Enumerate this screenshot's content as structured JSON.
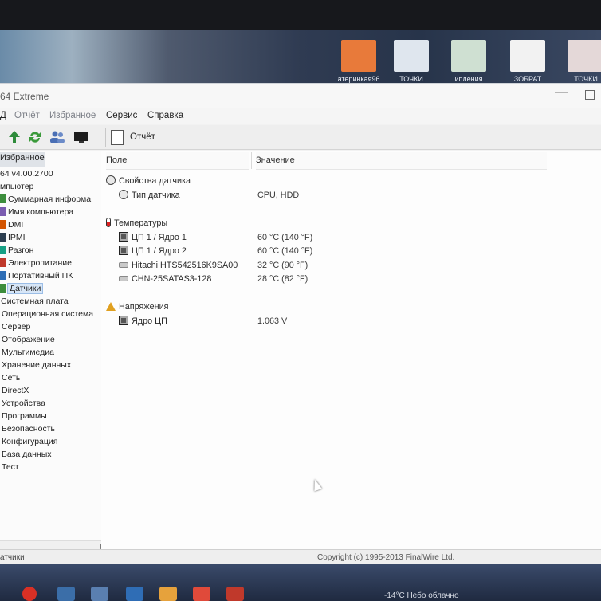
{
  "window": {
    "title": "64 Extreme"
  },
  "menu": [
    {
      "label": "Отчёт",
      "dim": true
    },
    {
      "label": "Избранное",
      "dim": true
    },
    {
      "label": "Сервис",
      "dim": false
    },
    {
      "label": "Справка",
      "dim": false
    }
  ],
  "menu_prefix": "Д",
  "desktop": {
    "labels": [
      "атеринкая96",
      "ТОЧКИ",
      "ипления",
      "ЗОБРАТ",
      "ТОЧКИ"
    ]
  },
  "toolbar": {
    "report_label": "Отчёт",
    "icons": [
      "up-arrow-icon",
      "refresh-icon",
      "users-icon",
      "monitor-icon"
    ]
  },
  "tree": {
    "header": "Избранное",
    "items": [
      {
        "label": "64 v4.00.2700",
        "level": 0
      },
      {
        "label": "мпьютер",
        "level": 0
      },
      {
        "label": "Суммарная информа",
        "level": 1
      },
      {
        "label": "Имя компьютера",
        "level": 1
      },
      {
        "label": "DMI",
        "level": 1
      },
      {
        "label": "IPMI",
        "level": 1
      },
      {
        "label": "Разгон",
        "level": 1
      },
      {
        "label": "Электропитание",
        "level": 1
      },
      {
        "label": "Портативный ПК",
        "level": 1
      },
      {
        "label": "Датчики",
        "level": 1,
        "selected": true
      },
      {
        "label": "Системная плата",
        "level": 0
      },
      {
        "label": "Операционная система",
        "level": 0
      },
      {
        "label": "Сервер",
        "level": 0
      },
      {
        "label": "Отображение",
        "level": 0
      },
      {
        "label": "Мультимедиа",
        "level": 0
      },
      {
        "label": "Хранение данных",
        "level": 0
      },
      {
        "label": "Сеть",
        "level": 0
      },
      {
        "label": "DirectX",
        "level": 0
      },
      {
        "label": "Устройства",
        "level": 0
      },
      {
        "label": "Программы",
        "level": 0
      },
      {
        "label": "Безопасность",
        "level": 0
      },
      {
        "label": "Конфигурация",
        "level": 0
      },
      {
        "label": "База данных",
        "level": 0
      },
      {
        "label": "Тест",
        "level": 0
      }
    ]
  },
  "columns": {
    "field": "Поле",
    "value": "Значение"
  },
  "sections": [
    {
      "title": "Свойства датчика",
      "icon": "gauge-icon",
      "rows": [
        {
          "field": "Тип датчика",
          "value": "CPU, HDD",
          "icon": "gauge-icon"
        }
      ]
    },
    {
      "title": "Температуры",
      "icon": "thermometer-icon",
      "rows": [
        {
          "field": "ЦП 1 / Ядро 1",
          "value": "60 °C  (140 °F)",
          "icon": "cpu-icon"
        },
        {
          "field": "ЦП 1 / Ядро 2",
          "value": "60 °C  (140 °F)",
          "icon": "cpu-icon"
        },
        {
          "field": "Hitachi HTS542516K9SA00",
          "value": "32 °C  (90 °F)",
          "icon": "hdd-icon"
        },
        {
          "field": "CHN-25SATAS3-128",
          "value": "28 °C  (82 °F)",
          "icon": "hdd-icon"
        }
      ]
    },
    {
      "title": "Напряжения",
      "icon": "warning-icon",
      "rows": [
        {
          "field": "Ядро ЦП",
          "value": "1.063 V",
          "icon": "cpu-icon"
        }
      ]
    }
  ],
  "status": {
    "left": "атчики",
    "right": "Copyright (c) 1995-2013 FinalWire Ltd."
  },
  "taskbar": {
    "tray_text": "-14°C  Небо облачно"
  }
}
